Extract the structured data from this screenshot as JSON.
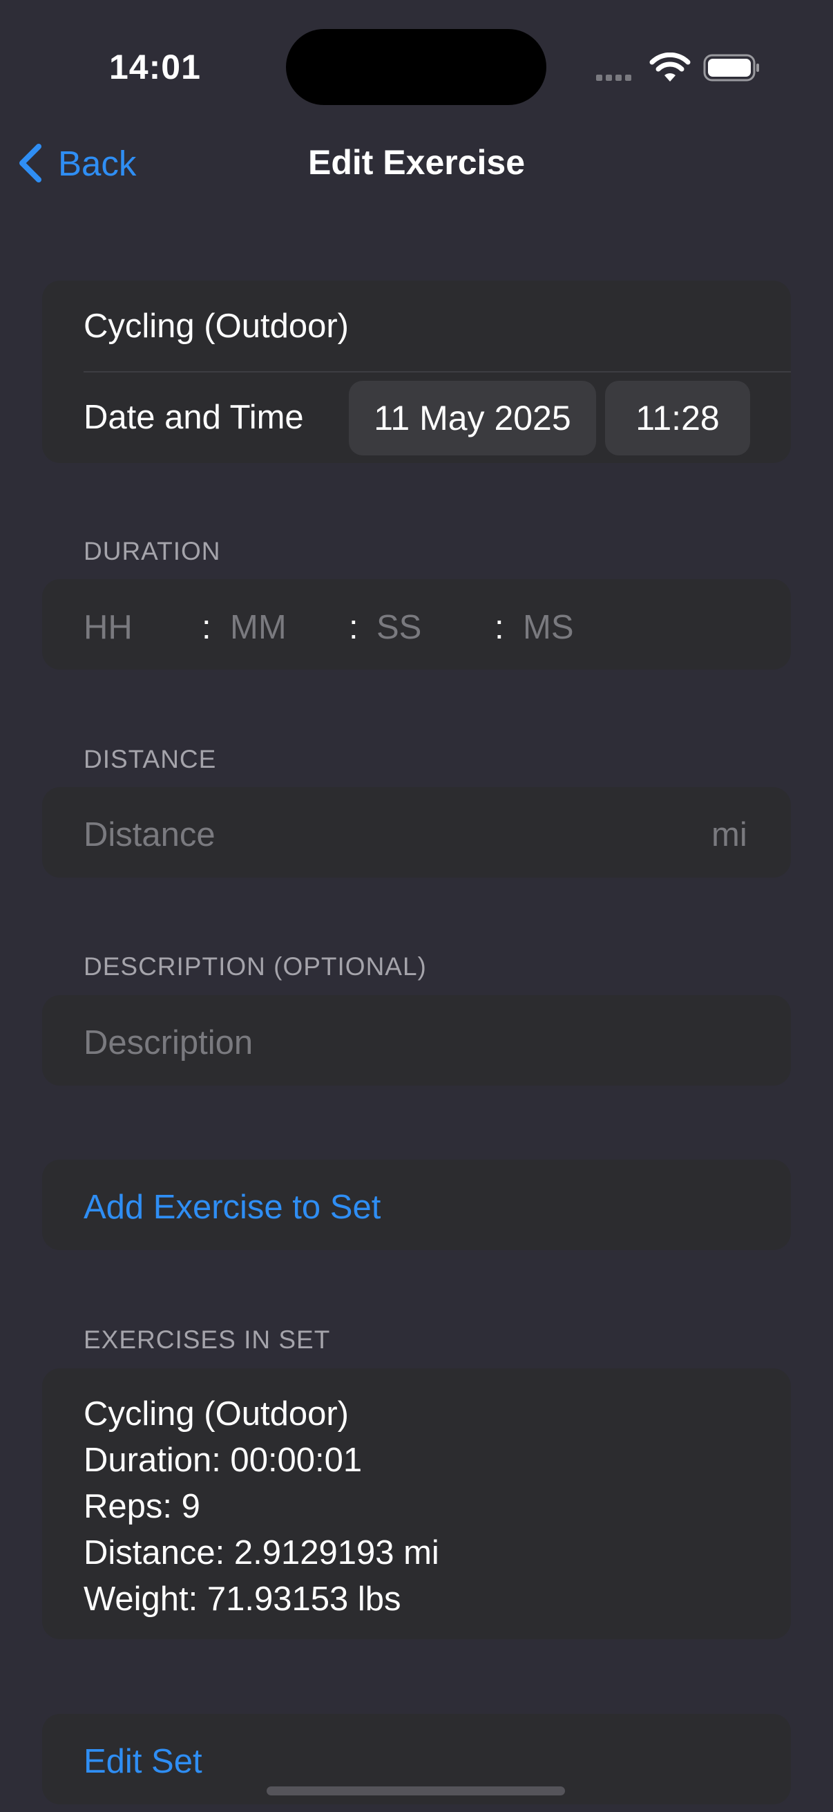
{
  "status_bar": {
    "time": "14:01"
  },
  "nav": {
    "back_label": "Back",
    "title": "Edit Exercise"
  },
  "exercise_card": {
    "exercise_name": "Cycling (Outdoor)",
    "date_time_label": "Date and Time",
    "date_value": "11 May 2025",
    "time_value": "11:28"
  },
  "duration": {
    "section_label": "DURATION",
    "hh_placeholder": "HH",
    "mm_placeholder": "MM",
    "ss_placeholder": "SS",
    "ms_placeholder": "MS",
    "separator": ":"
  },
  "distance": {
    "section_label": "DISTANCE",
    "placeholder": "Distance",
    "unit": "mi"
  },
  "description": {
    "section_label": "DESCRIPTION (OPTIONAL)",
    "placeholder": "Description"
  },
  "add_to_set": {
    "label": "Add Exercise to Set"
  },
  "exercises_in_set": {
    "section_label": "EXERCISES IN SET",
    "lines": [
      "Cycling (Outdoor)",
      "Duration: 00:00:01",
      "Reps: 9",
      "Distance: 2.9129193 mi",
      "Weight: 71.93153 lbs"
    ]
  },
  "edit_set": {
    "label": "Edit Set"
  },
  "colors": {
    "background": "#2e2d37",
    "card": "#2c2c2f",
    "accent": "#2f8ef4"
  }
}
